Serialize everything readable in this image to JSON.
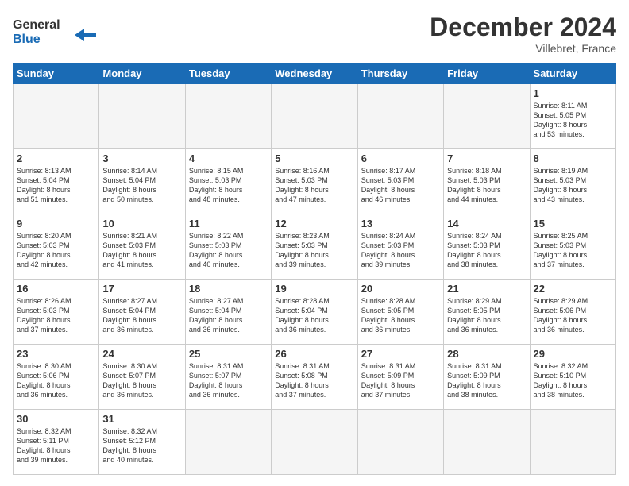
{
  "header": {
    "logo_line1": "General",
    "logo_line2": "Blue",
    "month": "December 2024",
    "location": "Villebret, France"
  },
  "weekdays": [
    "Sunday",
    "Monday",
    "Tuesday",
    "Wednesday",
    "Thursday",
    "Friday",
    "Saturday"
  ],
  "days": [
    {
      "num": "",
      "info": ""
    },
    {
      "num": "",
      "info": ""
    },
    {
      "num": "",
      "info": ""
    },
    {
      "num": "",
      "info": ""
    },
    {
      "num": "",
      "info": ""
    },
    {
      "num": "",
      "info": ""
    },
    {
      "num": "1",
      "info": "Sunrise: 8:11 AM\nSunset: 5:05 PM\nDaylight: 8 hours\nand 53 minutes."
    },
    {
      "num": "2",
      "info": "Sunrise: 8:13 AM\nSunset: 5:04 PM\nDaylight: 8 hours\nand 51 minutes."
    },
    {
      "num": "3",
      "info": "Sunrise: 8:14 AM\nSunset: 5:04 PM\nDaylight: 8 hours\nand 50 minutes."
    },
    {
      "num": "4",
      "info": "Sunrise: 8:15 AM\nSunset: 5:03 PM\nDaylight: 8 hours\nand 48 minutes."
    },
    {
      "num": "5",
      "info": "Sunrise: 8:16 AM\nSunset: 5:03 PM\nDaylight: 8 hours\nand 47 minutes."
    },
    {
      "num": "6",
      "info": "Sunrise: 8:17 AM\nSunset: 5:03 PM\nDaylight: 8 hours\nand 46 minutes."
    },
    {
      "num": "7",
      "info": "Sunrise: 8:18 AM\nSunset: 5:03 PM\nDaylight: 8 hours\nand 44 minutes."
    },
    {
      "num": "8",
      "info": "Sunrise: 8:19 AM\nSunset: 5:03 PM\nDaylight: 8 hours\nand 43 minutes."
    },
    {
      "num": "9",
      "info": "Sunrise: 8:20 AM\nSunset: 5:03 PM\nDaylight: 8 hours\nand 42 minutes."
    },
    {
      "num": "10",
      "info": "Sunrise: 8:21 AM\nSunset: 5:03 PM\nDaylight: 8 hours\nand 41 minutes."
    },
    {
      "num": "11",
      "info": "Sunrise: 8:22 AM\nSunset: 5:03 PM\nDaylight: 8 hours\nand 40 minutes."
    },
    {
      "num": "12",
      "info": "Sunrise: 8:23 AM\nSunset: 5:03 PM\nDaylight: 8 hours\nand 39 minutes."
    },
    {
      "num": "13",
      "info": "Sunrise: 8:24 AM\nSunset: 5:03 PM\nDaylight: 8 hours\nand 39 minutes."
    },
    {
      "num": "14",
      "info": "Sunrise: 8:24 AM\nSunset: 5:03 PM\nDaylight: 8 hours\nand 38 minutes."
    },
    {
      "num": "15",
      "info": "Sunrise: 8:25 AM\nSunset: 5:03 PM\nDaylight: 8 hours\nand 37 minutes."
    },
    {
      "num": "16",
      "info": "Sunrise: 8:26 AM\nSunset: 5:03 PM\nDaylight: 8 hours\nand 37 minutes."
    },
    {
      "num": "17",
      "info": "Sunrise: 8:27 AM\nSunset: 5:04 PM\nDaylight: 8 hours\nand 36 minutes."
    },
    {
      "num": "18",
      "info": "Sunrise: 8:27 AM\nSunset: 5:04 PM\nDaylight: 8 hours\nand 36 minutes."
    },
    {
      "num": "19",
      "info": "Sunrise: 8:28 AM\nSunset: 5:04 PM\nDaylight: 8 hours\nand 36 minutes."
    },
    {
      "num": "20",
      "info": "Sunrise: 8:28 AM\nSunset: 5:05 PM\nDaylight: 8 hours\nand 36 minutes."
    },
    {
      "num": "21",
      "info": "Sunrise: 8:29 AM\nSunset: 5:05 PM\nDaylight: 8 hours\nand 36 minutes."
    },
    {
      "num": "22",
      "info": "Sunrise: 8:29 AM\nSunset: 5:06 PM\nDaylight: 8 hours\nand 36 minutes."
    },
    {
      "num": "23",
      "info": "Sunrise: 8:30 AM\nSunset: 5:06 PM\nDaylight: 8 hours\nand 36 minutes."
    },
    {
      "num": "24",
      "info": "Sunrise: 8:30 AM\nSunset: 5:07 PM\nDaylight: 8 hours\nand 36 minutes."
    },
    {
      "num": "25",
      "info": "Sunrise: 8:31 AM\nSunset: 5:07 PM\nDaylight: 8 hours\nand 36 minutes."
    },
    {
      "num": "26",
      "info": "Sunrise: 8:31 AM\nSunset: 5:08 PM\nDaylight: 8 hours\nand 37 minutes."
    },
    {
      "num": "27",
      "info": "Sunrise: 8:31 AM\nSunset: 5:09 PM\nDaylight: 8 hours\nand 37 minutes."
    },
    {
      "num": "28",
      "info": "Sunrise: 8:31 AM\nSunset: 5:09 PM\nDaylight: 8 hours\nand 38 minutes."
    },
    {
      "num": "29",
      "info": "Sunrise: 8:32 AM\nSunset: 5:10 PM\nDaylight: 8 hours\nand 38 minutes."
    },
    {
      "num": "30",
      "info": "Sunrise: 8:32 AM\nSunset: 5:11 PM\nDaylight: 8 hours\nand 39 minutes."
    },
    {
      "num": "31",
      "info": "Sunrise: 8:32 AM\nSunset: 5:12 PM\nDaylight: 8 hours\nand 40 minutes."
    },
    {
      "num": "",
      "info": ""
    },
    {
      "num": "",
      "info": ""
    },
    {
      "num": "",
      "info": ""
    },
    {
      "num": "",
      "info": ""
    },
    {
      "num": "",
      "info": ""
    },
    {
      "num": "",
      "info": ""
    }
  ]
}
